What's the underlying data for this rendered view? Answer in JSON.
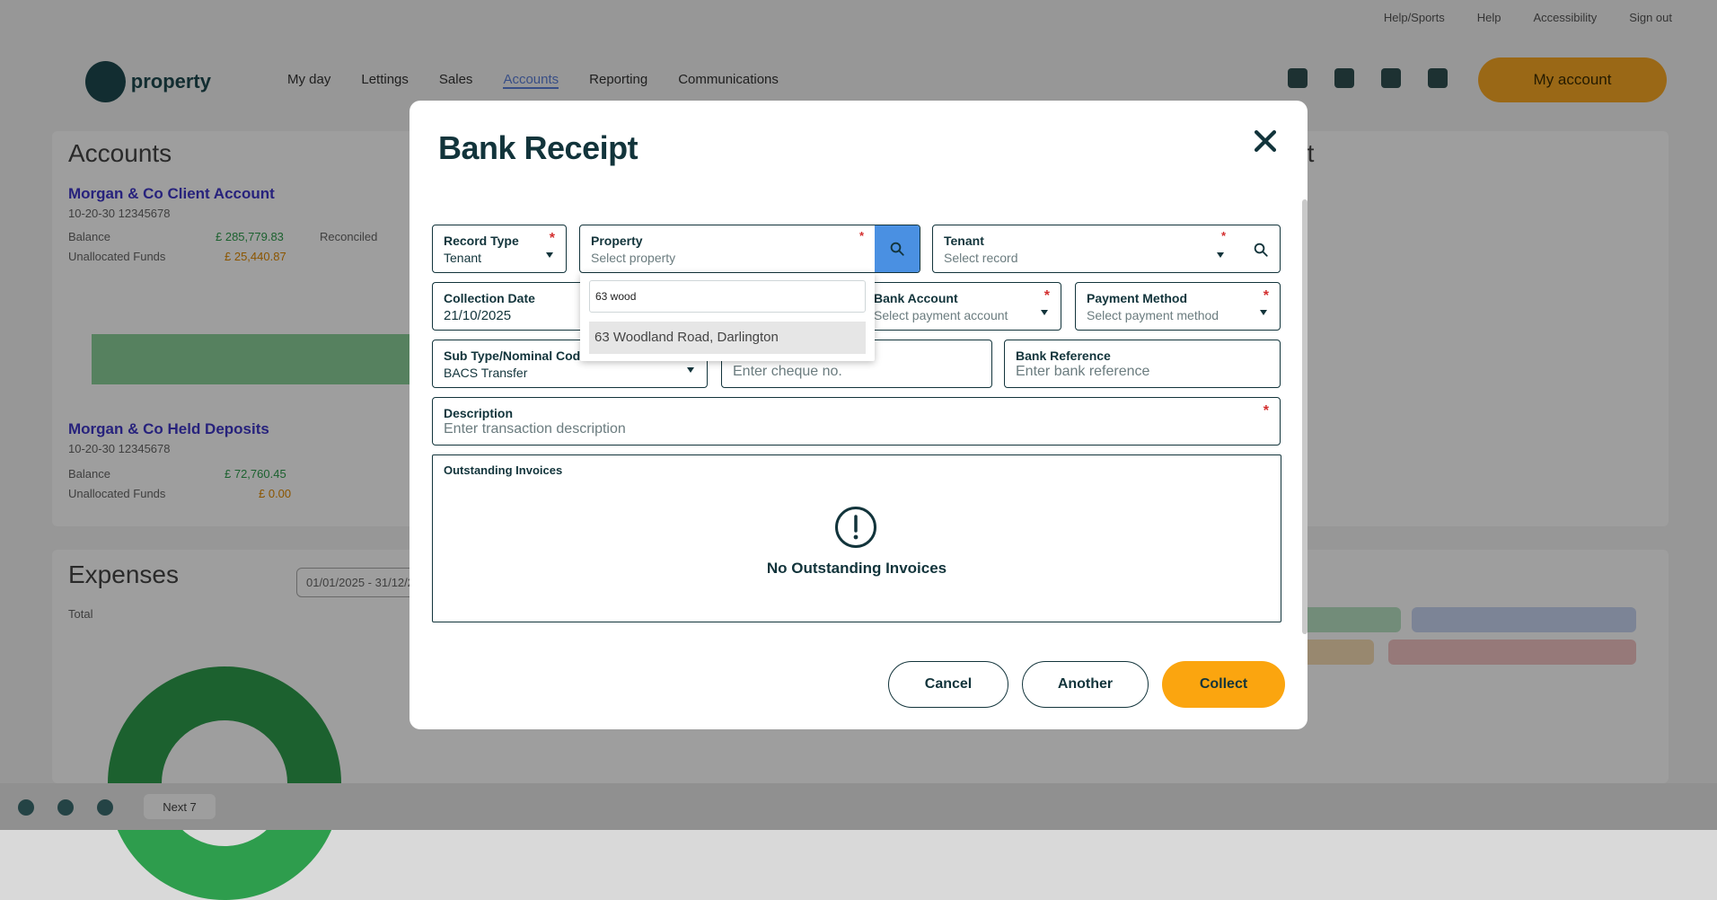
{
  "background": {
    "top_links": [
      "Help/Sports",
      "Help",
      "Accessibility",
      "Sign out"
    ],
    "brand": "property",
    "nav": [
      "My day",
      "Lettings",
      "Sales",
      "Accounts",
      "Reporting",
      "Communications"
    ],
    "my_account": "My account",
    "accounts_card": {
      "title": "Accounts",
      "account1": "Morgan & Co Client Account",
      "account1_sub": "10-20-30 12345678",
      "balance_label": "Balance",
      "balance1": "£ 285,779.83",
      "unallocated_label": "Unallocated Funds",
      "unallocated1": "£ 25,440.87",
      "reconciled_label": "Reconciled",
      "account2": "Morgan & Co Held Deposits",
      "account2_sub": "10-20-30 12345678",
      "balance2": "£ 72,760.45",
      "unallocated2": "£ 0.00"
    },
    "expenses_card": {
      "title": "Expenses",
      "sub": "Total",
      "date_range": "01/01/2025 - 31/12/2025"
    },
    "right_card": {
      "title": "et"
    },
    "bottom_nav": "Next 7"
  },
  "modal": {
    "title": "Bank Receipt",
    "close_icon": "close-icon",
    "fields": {
      "record_type": {
        "label": "Record Type",
        "value": "Tenant",
        "required": "*"
      },
      "property": {
        "label": "Property",
        "placeholder": "Select property",
        "required": "*"
      },
      "tenant": {
        "label": "Tenant",
        "placeholder": "Select record",
        "required": "*"
      },
      "collection_date": {
        "label": "Collection Date",
        "value": "21/10/2025"
      },
      "bank_account": {
        "label": "Bank Account",
        "placeholder": "Select payment account",
        "required": "*"
      },
      "payment_method": {
        "label": "Payment Method",
        "placeholder": "Select payment method",
        "required": "*"
      },
      "sub_type": {
        "label": "Sub Type/Nominal Code",
        "value": "BACS Transfer"
      },
      "cheque": {
        "placeholder": "Enter cheque no."
      },
      "bank_reference": {
        "label": "Bank Reference",
        "placeholder": "Enter bank reference"
      },
      "description": {
        "label": "Description",
        "placeholder": "Enter transaction description",
        "required": "*"
      }
    },
    "property_dropdown": {
      "search_value": "63 wood",
      "options": [
        "63 Woodland Road, Darlington"
      ]
    },
    "outstanding_invoices": {
      "title": "Outstanding Invoices",
      "empty_message": "No Outstanding Invoices",
      "icon": "exclamation-circle-icon"
    },
    "buttons": {
      "cancel": "Cancel",
      "another": "Another",
      "collect": "Collect"
    },
    "colors": {
      "primary": "#fba50f",
      "search_accent": "#4a90e2",
      "text": "#12343b",
      "required": "#d32f2f"
    }
  }
}
